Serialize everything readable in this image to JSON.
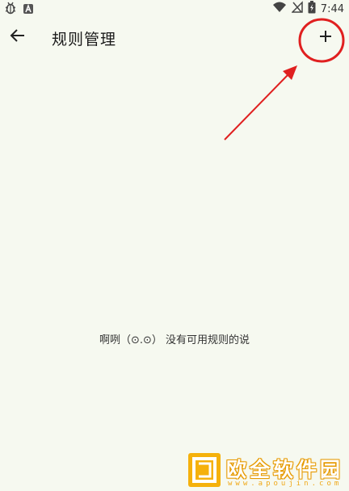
{
  "status_bar": {
    "time": "7:44",
    "icons": [
      "bug-icon",
      "a-badge-icon",
      "wifi-icon",
      "signal-off-icon",
      "battery-icon"
    ]
  },
  "toolbar": {
    "title": "规则管理",
    "back_icon": "arrow-left-icon",
    "add_icon": "plus-icon"
  },
  "content": {
    "empty_message": "啊咧（⊙.⊙） 没有可用规则的说"
  },
  "annotation": {
    "color": "#e02020"
  },
  "watermark": {
    "title": "欧全软件园",
    "domain": "www.apoujin.com",
    "color": "#f0a818"
  }
}
